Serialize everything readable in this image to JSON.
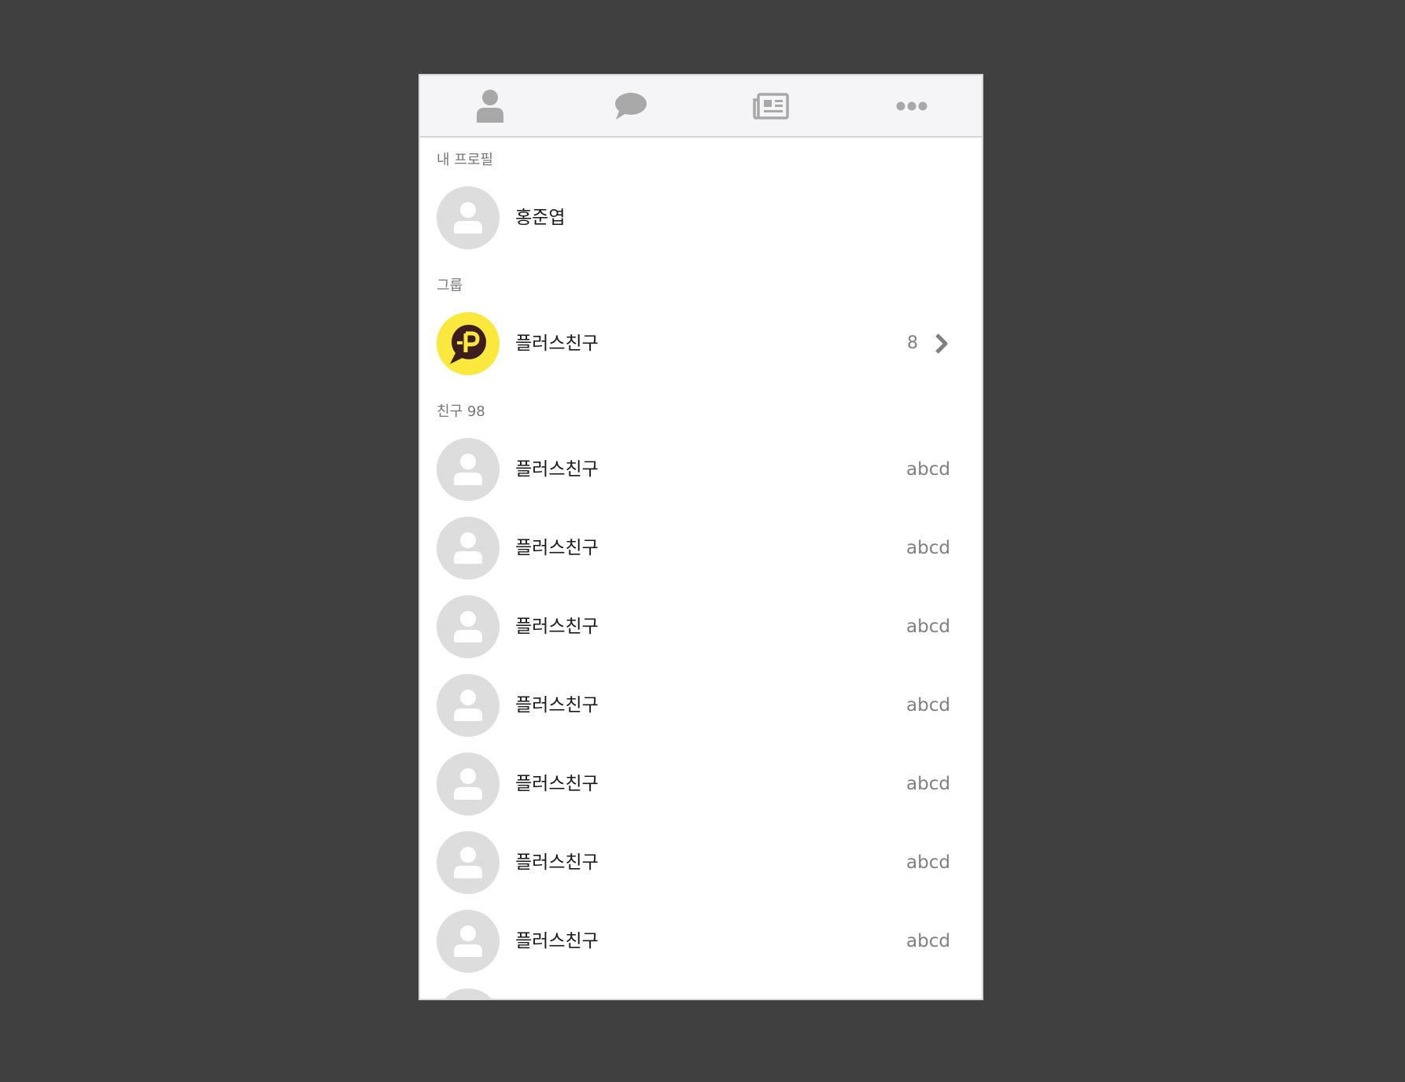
{
  "tabs": [
    {
      "name": "friends-tab",
      "icon": "person-icon"
    },
    {
      "name": "chats-tab",
      "icon": "chat-bubble-icon"
    },
    {
      "name": "news-tab",
      "icon": "newspaper-icon"
    },
    {
      "name": "more-tab",
      "icon": "more-dots-icon"
    }
  ],
  "my_profile": {
    "section_label": "내 프로필",
    "name": "홍준엽"
  },
  "group": {
    "section_label": "그룹",
    "name": "플러스친구",
    "count": "8",
    "icon": "plus-friend-logo"
  },
  "friends": {
    "section_label": "친구 98",
    "items": [
      {
        "name": "플러스친구",
        "status": "abcd"
      },
      {
        "name": "플러스친구",
        "status": "abcd"
      },
      {
        "name": "플러스친구",
        "status": "abcd"
      },
      {
        "name": "플러스친구",
        "status": "abcd"
      },
      {
        "name": "플러스친구",
        "status": "abcd"
      },
      {
        "name": "플러스친구",
        "status": "abcd"
      },
      {
        "name": "플러스친구",
        "status": "abcd"
      },
      {
        "name": "",
        "status": ""
      }
    ]
  },
  "colors": {
    "background": "#404040",
    "tab_icon": "#a8a8a8",
    "avatar_bg": "#dddddd",
    "plus_yellow": "#fbe83d",
    "plus_brown": "#3c1e1e"
  }
}
